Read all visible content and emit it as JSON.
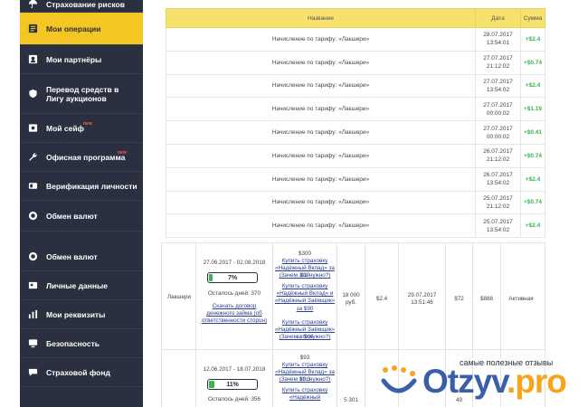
{
  "sidebar_top": {
    "items": [
      {
        "label": "Страхование рисков",
        "icon": "umbrella-icon",
        "active": false
      },
      {
        "label": "Мои операции",
        "icon": "list-icon",
        "active": true
      },
      {
        "label": "Мои партнёры",
        "icon": "users-icon",
        "active": false
      },
      {
        "label": "Перевод средств в Лигу аукционов",
        "icon": "shield-icon",
        "active": false
      },
      {
        "label": "Мой сейф",
        "icon": "safe-icon",
        "active": false,
        "badge": "new"
      },
      {
        "label": "Офисная программа",
        "icon": "wrench-icon",
        "active": false,
        "badge": "new"
      },
      {
        "label": "Верификация личности",
        "icon": "id-card-icon",
        "active": false
      },
      {
        "label": "Обмен валют",
        "icon": "exchange-icon",
        "active": false
      }
    ]
  },
  "operations": {
    "headers": {
      "name": "Название",
      "date": "Дата",
      "sum": "Сумма"
    },
    "rows": [
      {
        "name": "Начисление по тарифу: «Лакшери»",
        "date": "28.07.2017",
        "time": "13:54:01",
        "sum": "+$2.4"
      },
      {
        "name": "Начисление по тарифу: «Лакшери»",
        "date": "27.07.2017",
        "time": "21:12:02",
        "sum": "+$0.74"
      },
      {
        "name": "Начисление по тарифу: «Лакшери»",
        "date": "27.07.2017",
        "time": "13:54:02",
        "sum": "+$2.4"
      },
      {
        "name": "Начисление по тарифу: «Лакшери»",
        "date": "27.07.2017",
        "time": "00:00:02",
        "sum": "+$1.19"
      },
      {
        "name": "Начисление по тарифу: «Лакшери»",
        "date": "27.07.2017",
        "time": "00:00:02",
        "sum": "+$0.41"
      },
      {
        "name": "Начисление по тарифу: «Лакшери»",
        "date": "26.07.2017",
        "time": "21:12:02",
        "sum": "+$0.74"
      },
      {
        "name": "Начисление по тарифу: «Лакшери»",
        "date": "26.07.2017",
        "time": "13:54:02",
        "sum": "+$2.4"
      },
      {
        "name": "Начисление по тарифу: «Лакшери»",
        "date": "25.07.2017",
        "time": "21:12:02",
        "sum": "+$0.74"
      },
      {
        "name": "Начисление по тарифу: «Лакшери»",
        "date": "25.07.2017",
        "time": "13:54:02",
        "sum": "+$2.4"
      }
    ]
  },
  "sidebar_bottom": {
    "items": [
      {
        "label": "Обмен валют",
        "icon": "exchange-icon"
      },
      {
        "label": "Личные данные",
        "icon": "profile-icon"
      },
      {
        "label": "Мои реквизиты",
        "icon": "chart-icon"
      },
      {
        "label": "Безопасность",
        "icon": "monitor-icon"
      },
      {
        "label": "Страховой фонд",
        "icon": "chat-icon"
      }
    ]
  },
  "insurance": {
    "rows": [
      {
        "tariff": "Лакшери",
        "period": "27.06.2017 - 02.08.2018",
        "progress_percent": 7,
        "progress_label": "7%",
        "days_left": "Осталось дней: 370",
        "contract_link": "Скачать договор денежного займа (об ответственности сторон)",
        "offer1_price": "$300",
        "offer1_link": "Купить страховку «Надёжный Вклад» за $30",
        "offer1_note": "(Зачем это нужно?)",
        "offer2_link": "Купить страховку «Надёжный Вклад» и «Надёжный Заёмщик» за $90",
        "offer3_link": "Купить страховку «Надёжный Заёмщик» за $60",
        "offer3_note": "(Зачем это нужно?)",
        "amount": "18 000 руб.",
        "rate": "$2.4",
        "datetime": "29.07.2017 13:51:46",
        "v1": "$72",
        "v2": "$888",
        "status": "Активная"
      },
      {
        "tariff": "",
        "period": "12.06.2017 - 18.07.2018",
        "progress_percent": 11,
        "progress_label": "11%",
        "days_left": "Осталось дней: 356",
        "offer1_price": "$93",
        "offer1_link": "Купить страховку «Надёжный Вклад» за $9.3",
        "offer1_note": "(Зачем это нужно?)",
        "offer2_link": "Купить страховку «Надёжный",
        "amount": "5 301",
        "v1": "49"
      }
    ]
  },
  "watermark": {
    "tagline": "самые полезные отзывы",
    "brand_main": "Otzyv",
    "brand_suffix": ".pro"
  },
  "colors": {
    "sidebar": "#2b3040",
    "active": "#f3c623",
    "header": "#f7e16d",
    "positive": "#3ab54a",
    "link": "#2a3f8f",
    "brand_blue": "#3b5ea8",
    "brand_orange": "#f4a51c"
  }
}
